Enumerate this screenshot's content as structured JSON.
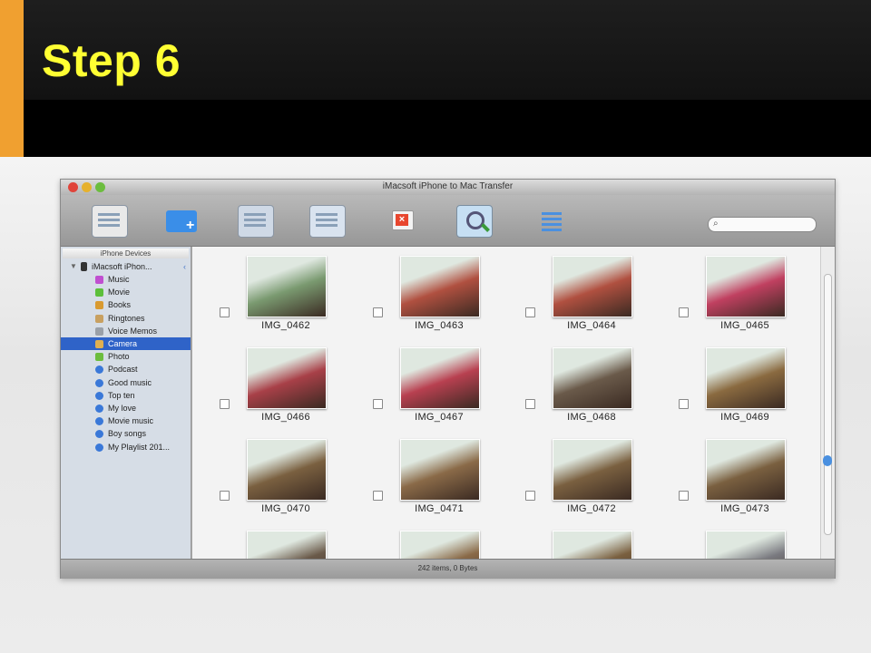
{
  "slide": {
    "title": "Step 6",
    "accent_color": "#f0a030",
    "title_color": "#ffff33"
  },
  "window": {
    "title": "iMacsoft iPhone to Mac Transfer",
    "toolbar": [
      {
        "name": "import-to-iphone-icon",
        "color": "#e9e9e9"
      },
      {
        "name": "add-folder-icon",
        "color": "#3a8ee8"
      },
      {
        "name": "export-to-mac-icon",
        "color": "#cfd9e6"
      },
      {
        "name": "checklist-icon",
        "color": "#d9e3ef"
      },
      {
        "name": "delete-icon",
        "color": "#e8462e"
      },
      {
        "name": "search-zoom-icon",
        "color": "#c6dff3"
      },
      {
        "name": "menu-list-icon",
        "color": "#4a90e0"
      }
    ],
    "search_placeholder": ""
  },
  "sidebar": {
    "header": "iPhone Devices",
    "device": "iMacsoft iPhon...",
    "items": [
      {
        "label": "Music",
        "icon": "music-icon",
        "color": "#c04fd0"
      },
      {
        "label": "Movie",
        "icon": "movie-icon",
        "color": "#5cbf3a"
      },
      {
        "label": "Books",
        "icon": "books-icon",
        "color": "#d99a30"
      },
      {
        "label": "Ringtones",
        "icon": "ringtones-icon",
        "color": "#c8a060"
      },
      {
        "label": "Voice Memos",
        "icon": "voice-memos-icon",
        "color": "#9aa0a8"
      },
      {
        "label": "Camera",
        "icon": "camera-icon",
        "color": "#e0b050",
        "selected": true
      },
      {
        "label": "Photo",
        "icon": "photo-icon",
        "color": "#6cbd3e"
      },
      {
        "label": "Podcast",
        "icon": "playlist-icon",
        "color": "#3a78d8"
      },
      {
        "label": "Good music",
        "icon": "playlist-icon",
        "color": "#3a78d8"
      },
      {
        "label": "Top ten",
        "icon": "playlist-icon",
        "color": "#3a78d8"
      },
      {
        "label": "My love",
        "icon": "playlist-icon",
        "color": "#3a78d8"
      },
      {
        "label": "Movie music",
        "icon": "playlist-icon",
        "color": "#3a78d8"
      },
      {
        "label": "Boy songs",
        "icon": "playlist-icon",
        "color": "#3a78d8"
      },
      {
        "label": "My Playlist 201...",
        "icon": "playlist-icon",
        "color": "#3a78d8"
      }
    ]
  },
  "photos": [
    {
      "label": "IMG_0462",
      "tone": "#7a9a70"
    },
    {
      "label": "IMG_0463",
      "tone": "#b05040"
    },
    {
      "label": "IMG_0464",
      "tone": "#b05040"
    },
    {
      "label": "IMG_0465",
      "tone": "#c04060"
    },
    {
      "label": "IMG_0466",
      "tone": "#a84048"
    },
    {
      "label": "IMG_0467",
      "tone": "#b84050"
    },
    {
      "label": "IMG_0468",
      "tone": "#6a5a4a"
    },
    {
      "label": "IMG_0469",
      "tone": "#8a6a40"
    },
    {
      "label": "IMG_0470",
      "tone": "#7a6040"
    },
    {
      "label": "IMG_0471",
      "tone": "#8a6a48"
    },
    {
      "label": "IMG_0472",
      "tone": "#7a6040"
    },
    {
      "label": "IMG_0473",
      "tone": "#7a6040"
    },
    {
      "label": "",
      "tone": "#6a5a4a"
    },
    {
      "label": "",
      "tone": "#8a6a48"
    },
    {
      "label": "",
      "tone": "#7a6040"
    },
    {
      "label": "",
      "tone": "#7a7a80"
    }
  ],
  "status": "242 items, 0 Bytes"
}
